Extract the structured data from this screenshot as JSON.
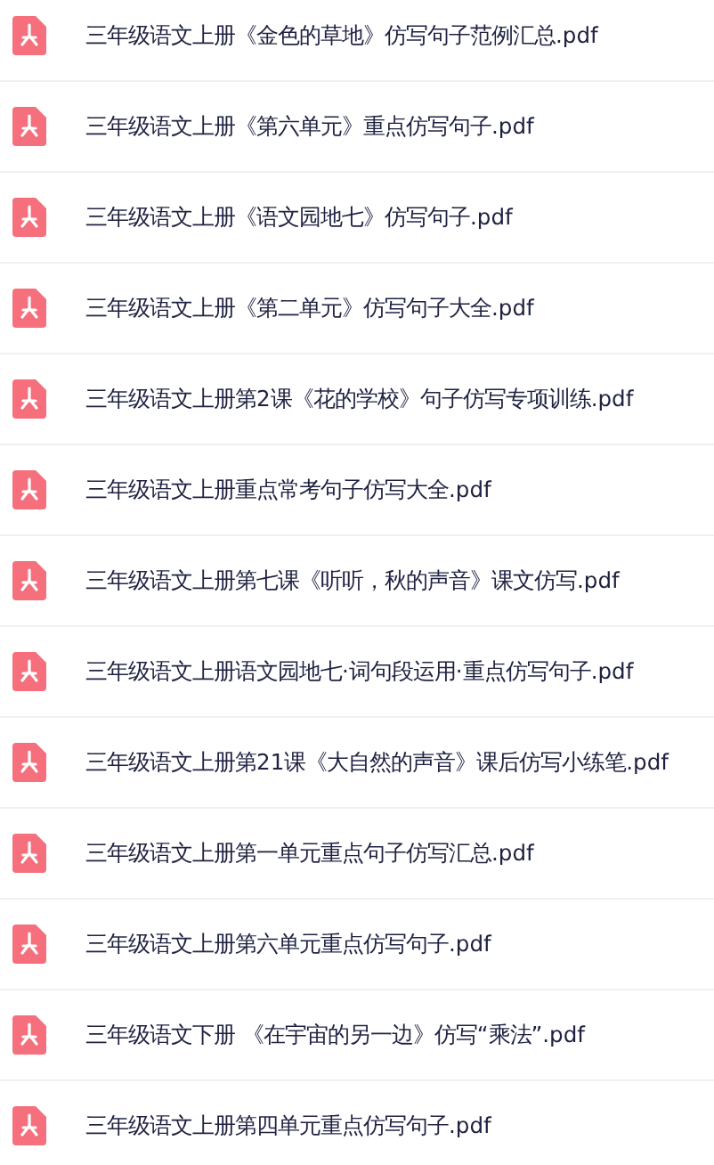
{
  "files": [
    {
      "name": "三年级语文上册《金色的草地》仿写句子范例汇总.pdf"
    },
    {
      "name": "三年级语文上册《第六单元》重点仿写句子.pdf"
    },
    {
      "name": "三年级语文上册《语文园地七》仿写句子.pdf"
    },
    {
      "name": "三年级语文上册《第二单元》仿写句子大全.pdf"
    },
    {
      "name": "三年级语文上册第2课《花的学校》句子仿写专项训练.pdf"
    },
    {
      "name": "三年级语文上册重点常考句子仿写大全.pdf"
    },
    {
      "name": "三年级语文上册第七课《听听，秋的声音》课文仿写.pdf"
    },
    {
      "name": "三年级语文上册语文园地七·词句段运用·重点仿写句子.pdf"
    },
    {
      "name": "三年级语文上册第21课《大自然的声音》课后仿写小练笔.pdf"
    },
    {
      "name": "三年级语文上册第一单元重点句子仿写汇总.pdf"
    },
    {
      "name": "三年级语文上册第六单元重点仿写句子.pdf"
    },
    {
      "name": "三年级语文下册 《在宇宙的另一边》仿写“乘法”.pdf"
    },
    {
      "name": "三年级语文上册第四单元重点仿写句子.pdf"
    }
  ]
}
